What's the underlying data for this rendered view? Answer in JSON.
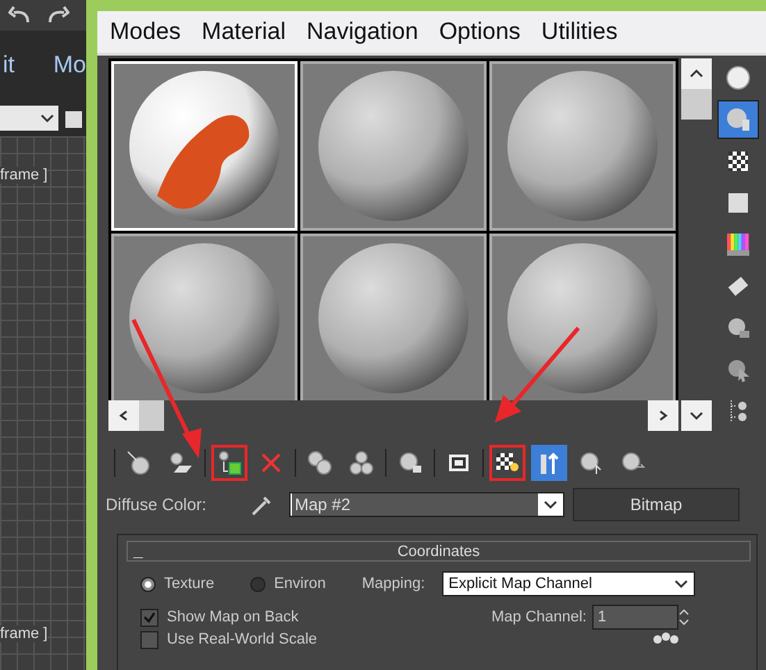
{
  "left_strip": {
    "labels": [
      "it",
      "Mo"
    ],
    "frame_labels": [
      "frame ]",
      "frame ]"
    ]
  },
  "menu": [
    "Modes",
    "Material",
    "Navigation",
    "Options",
    "Utilities"
  ],
  "slots": [
    {
      "kind": "textured",
      "selected": true
    },
    {
      "kind": "plain",
      "selected": false
    },
    {
      "kind": "plain",
      "selected": false
    },
    {
      "kind": "plain",
      "selected": false
    },
    {
      "kind": "plain",
      "selected": false
    },
    {
      "kind": "plain",
      "selected": false
    }
  ],
  "side_tools": [
    {
      "kind": "sphere",
      "selected": false
    },
    {
      "kind": "backlight",
      "selected": true
    },
    {
      "kind": "checker",
      "selected": false
    },
    {
      "kind": "square",
      "selected": false
    },
    {
      "kind": "colors",
      "selected": false
    },
    {
      "kind": "film",
      "selected": false
    },
    {
      "kind": "options",
      "selected": false
    },
    {
      "kind": "pick",
      "selected": false
    },
    {
      "kind": "navigator",
      "selected": false
    }
  ],
  "toolbar": [
    {
      "kind": "pick",
      "selected": false,
      "highlighted": false
    },
    {
      "kind": "put",
      "selected": false,
      "highlighted": false
    },
    {
      "kind": "assign",
      "selected": false,
      "highlighted": true
    },
    {
      "kind": "delete",
      "selected": false,
      "highlighted": false
    },
    {
      "kind": "copy",
      "selected": false,
      "highlighted": false
    },
    {
      "kind": "unique",
      "selected": false,
      "highlighted": false
    },
    {
      "kind": "library",
      "selected": false,
      "highlighted": false
    },
    {
      "kind": "id",
      "selected": false,
      "highlighted": false
    },
    {
      "kind": "showmap",
      "selected": false,
      "highlighted": true
    },
    {
      "kind": "result",
      "selected": true,
      "highlighted": false
    },
    {
      "kind": "parent",
      "selected": false,
      "highlighted": false
    },
    {
      "kind": "forward",
      "selected": false,
      "highlighted": false
    }
  ],
  "diffuse": {
    "label": "Diffuse Color:",
    "map": "Map #2",
    "type": "Bitmap"
  },
  "coordinates": {
    "collapse": "_",
    "title": "Coordinates",
    "options": [
      {
        "label": "Texture",
        "selected": true
      },
      {
        "label": "Environ",
        "selected": false
      }
    ],
    "mapping_label": "Mapping:",
    "mapping": "Explicit Map Channel",
    "show_map_on_back": {
      "label": "Show Map on Back",
      "checked": true
    },
    "map_channel_label": "Map Channel:",
    "map_channel": "1",
    "real_world_scale": {
      "label": "Use Real-World Scale",
      "checked": false
    }
  }
}
